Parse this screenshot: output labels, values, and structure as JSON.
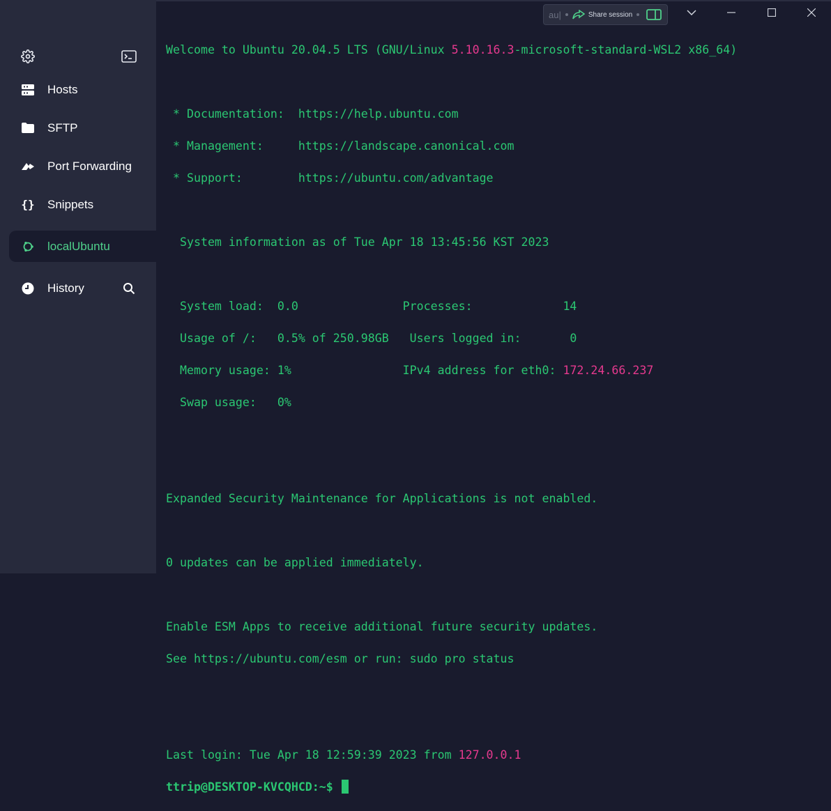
{
  "sidebar": {
    "items": [
      {
        "label": "Hosts"
      },
      {
        "label": "SFTP"
      },
      {
        "label": "Port Forwarding"
      },
      {
        "label": "Snippets"
      },
      {
        "label": "localUbuntu"
      },
      {
        "label": "History"
      }
    ],
    "active_color": "#4fd18b"
  },
  "titlebar": {
    "au_text": "au|",
    "share_label": "Share session"
  },
  "terminal": {
    "line1_a": "Welcome to Ubuntu 20.04.5 LTS (GNU/Linux ",
    "line1_b": "5.10.16.3",
    "line1_c": "-microsoft-standard-WSL2 x86_64)",
    "doc": " * Documentation:  https://help.ubuntu.com",
    "mgmt": " * Management:     https://landscape.canonical.com",
    "support": " * Support:        https://ubuntu.com/advantage",
    "sysinfo": "  System information as of Tue Apr 18 13:45:56 KST 2023",
    "load": "  System load:  0.0               Processes:             14",
    "usage": "  Usage of /:   0.5% of 250.98GB   Users logged in:       0",
    "mem_a": "  Memory usage: 1%                IPv4 address for eth0: ",
    "mem_b": "172.24.66.237",
    "swap": "  Swap usage:   0%",
    "esm": "Expanded Security Maintenance for Applications is not enabled.",
    "updates": "0 updates can be applied immediately.",
    "esm_apps": "Enable ESM Apps to receive additional future security updates.",
    "see": "See https://ubuntu.com/esm or run: sudo pro status",
    "last_a": "Last login: Tue Apr 18 12:59:39 2023 from ",
    "last_b": "127.0.0.1",
    "prompt": "ttrip@DESKTOP-KVCQHCD:~$ "
  },
  "colors": {
    "terminal_bg": "#191b2d",
    "sidebar_bg": "#272a3c",
    "terminal_green": "#2bc772",
    "terminal_pink": "#e6398e"
  },
  "icons": [
    "gear-icon",
    "terminal-icon",
    "server-icon",
    "folder-icon",
    "port-forward-icon",
    "braces-icon",
    "ubuntu-icon",
    "clock-icon",
    "search-icon",
    "share-arrow-icon",
    "split-pane-icon",
    "minimize-icon",
    "maximize-icon",
    "close-icon"
  ]
}
